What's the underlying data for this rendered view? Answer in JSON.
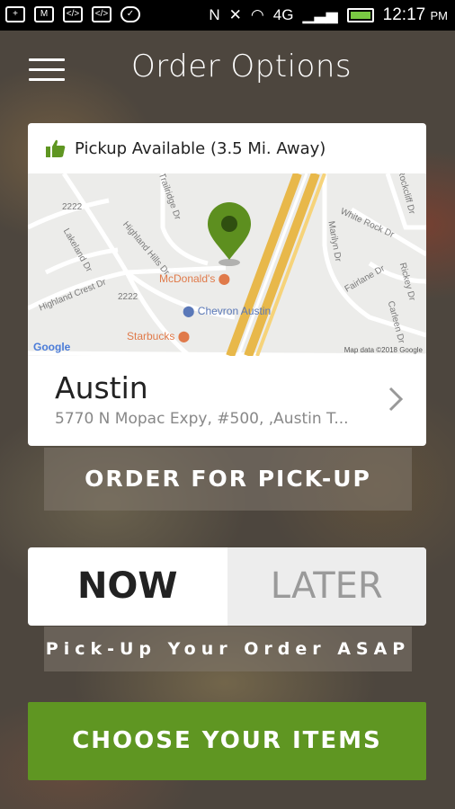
{
  "status_bar": {
    "time": "12:17",
    "ampm": "PM",
    "network": "4G"
  },
  "header": {
    "title": "Order Options"
  },
  "location_card": {
    "availability": "Pickup Available (3.5 Mi. Away)",
    "name": "Austin",
    "address": "5770 N Mopac Expy, #500, ,Austin T...",
    "map_labels": {
      "mcdonalds": "McDonald's",
      "chevron": "Chevron Austin",
      "starbucks": "Starbucks",
      "google": "Google",
      "map_data": "Map data ©2018 Google",
      "road_2222_a": "2222",
      "road_2222_b": "2222",
      "highland_crest": "Highland Crest Dr",
      "highland_hills": "Highland Hills Dr",
      "tombridge": "Trailridge Dr",
      "white_rock": "White Rock Dr",
      "marilyn": "Marilyn Dr",
      "fairlane": "Fairlane Dr",
      "lakeland": "Lakeland Dr",
      "rockcliff": "Rockcliff Dr",
      "ridge": "Rickey Dr",
      "carleen": "Carleen Dr"
    }
  },
  "buttons": {
    "order_pickup": "ORDER FOR PICK-UP",
    "now": "NOW",
    "later": "LATER",
    "asap": "Pick-Up Your Order ASAP",
    "choose_items": "CHOOSE YOUR ITEMS"
  },
  "colors": {
    "accent_green": "#5f9622",
    "pin_green": "#5d8f1f"
  }
}
